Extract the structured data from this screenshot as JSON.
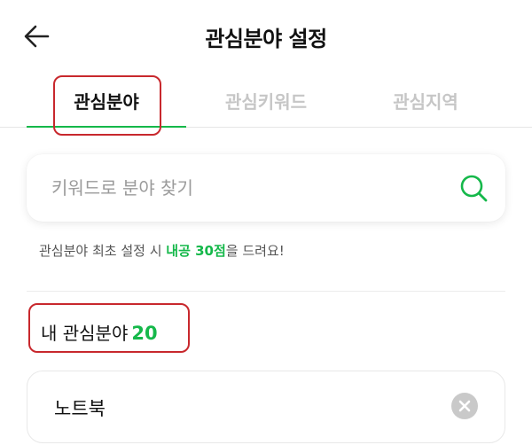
{
  "header": {
    "title": "관심분야 설정",
    "back_icon": "arrow-left-icon"
  },
  "tabs": [
    {
      "label": "관심분야",
      "active": true
    },
    {
      "label": "관심키워드",
      "active": false
    },
    {
      "label": "관심지역",
      "active": false
    }
  ],
  "search": {
    "placeholder": "키워드로 분야 찾기",
    "icon": "search-icon"
  },
  "notice": {
    "prefix": "관심분야 최초 설정 시 ",
    "highlight": "내공 30점",
    "suffix": "을 드려요!"
  },
  "my_interests": {
    "heading": "내 관심분야",
    "count": "20",
    "items": [
      {
        "label": "노트북"
      }
    ]
  },
  "colors": {
    "accent": "#15b84a",
    "annotation": "#c8282d",
    "inactive_tab": "#c6c6c6"
  }
}
